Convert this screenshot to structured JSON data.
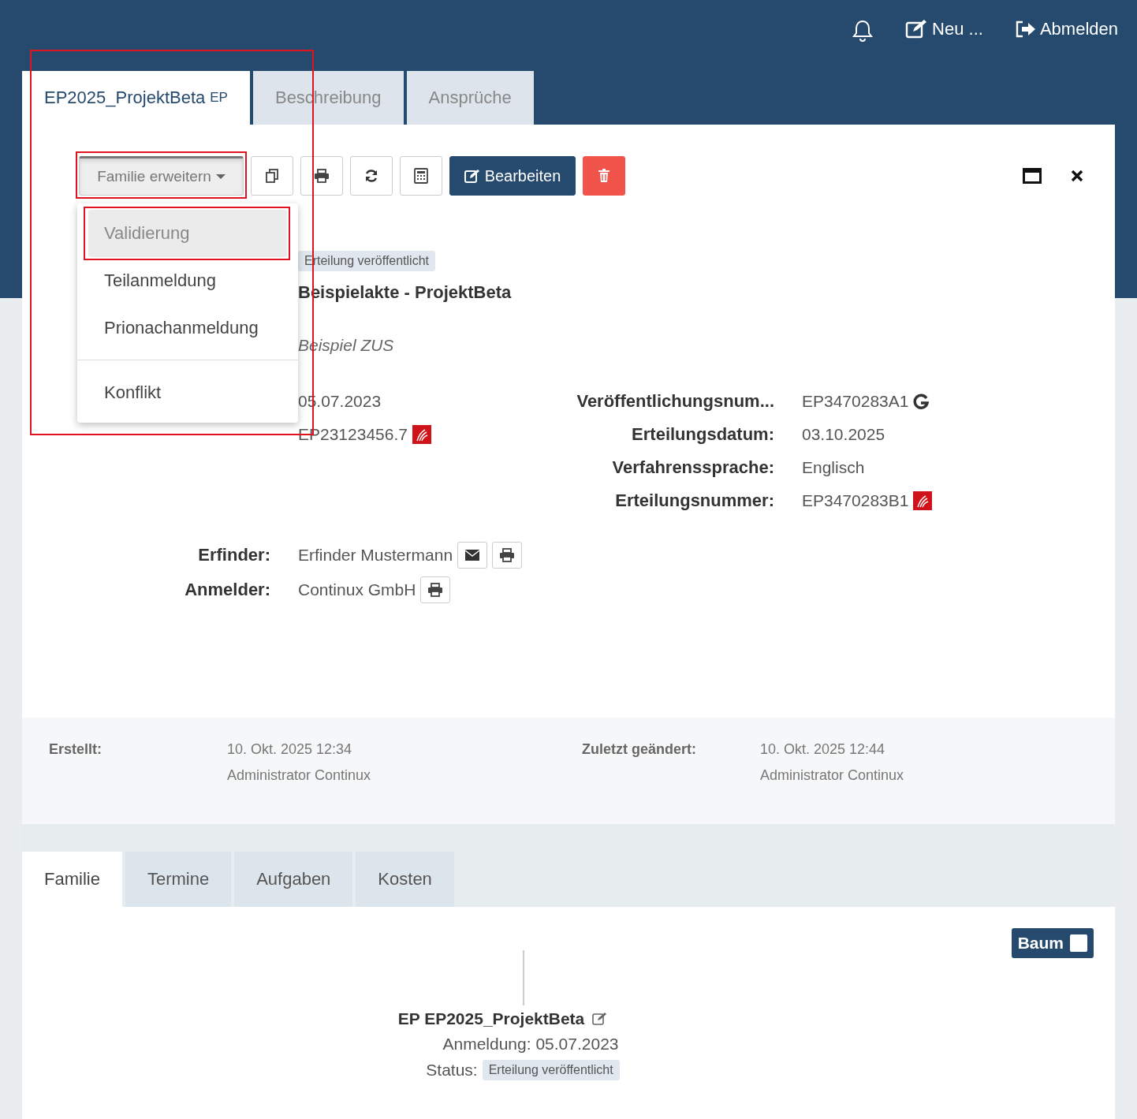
{
  "header": {
    "actions": [
      {
        "kind": "bell"
      },
      {
        "kind": "new",
        "label": "Neu ..."
      },
      {
        "kind": "logout",
        "label": "Abmelden"
      }
    ]
  },
  "tabs": [
    {
      "label": "EP2025_ProjektBeta",
      "suffix": "EP",
      "selected": true,
      "highlighted": true
    },
    {
      "label": "Beschreibung",
      "selected": false,
      "highlighted": false
    },
    {
      "label": "Ansprüche",
      "selected": false,
      "highlighted": false
    }
  ],
  "toolbar": {
    "dropdown": {
      "label": "Familie erweitern",
      "expanded": true,
      "highlighted": true
    },
    "buttons": [
      {
        "kind": "copy"
      },
      {
        "kind": "print"
      },
      {
        "kind": "refresh"
      },
      {
        "kind": "calculator"
      },
      {
        "kind": "edit",
        "label": "Bearbeiten"
      },
      {
        "kind": "delete"
      }
    ],
    "window_actions": [
      {
        "kind": "maximize"
      },
      {
        "kind": "close"
      }
    ]
  },
  "menu": {
    "items": [
      {
        "label": "Validierung",
        "selected": true,
        "highlighted": true,
        "divider_before": false
      },
      {
        "label": "Teilanmeldung",
        "selected": false,
        "highlighted": false,
        "divider_before": false
      },
      {
        "label": "Prionachanmeldung",
        "selected": false,
        "highlighted": false,
        "divider_before": false
      },
      {
        "label": "Konflikt",
        "selected": false,
        "highlighted": false,
        "divider_before": true
      }
    ]
  },
  "details": {
    "status": "Erteilung veröffentlicht",
    "title": "Beispielakte - ProjektBeta",
    "subtitle": "Beispiel ZUS",
    "fields_left": [
      {
        "value": "05.07.2023"
      },
      {
        "value": "EP23123456.7",
        "kind": "pdf"
      }
    ],
    "fields_right": [
      {
        "label": "Veröffentlichungsnum...",
        "value": "EP3470283A1",
        "kind": "google"
      },
      {
        "label": "Erteilungsdatum:",
        "value": "03.10.2025"
      },
      {
        "label": "Verfahrenssprache:",
        "value": "Englisch"
      },
      {
        "label": "Erteilungsnummer:",
        "value": "EP3470283B1",
        "kind": "pdf"
      }
    ],
    "parties": [
      {
        "label": "Erfinder:",
        "value": "Erfinder Mustermann",
        "actions": [
          {
            "kind": "mail"
          },
          {
            "kind": "print"
          }
        ]
      },
      {
        "label": "Anmelder:",
        "value": "Continux GmbH",
        "actions": [
          {
            "kind": "print"
          }
        ]
      }
    ]
  },
  "meta": [
    {
      "label": "Erstellt:",
      "date": "10. Okt. 2025 12:34",
      "user": "Administrator Continux"
    },
    {
      "label": "Zuletzt geändert:",
      "date": "10. Okt. 2025 12:44",
      "user": "Administrator Continux"
    }
  ],
  "bottom_tabs": [
    {
      "label": "Familie",
      "selected": true
    },
    {
      "label": "Termine",
      "selected": false
    },
    {
      "label": "Aufgaben",
      "selected": false
    },
    {
      "label": "Kosten",
      "selected": false
    }
  ],
  "tree": {
    "toggle": {
      "label": "Baum",
      "checked": false
    },
    "node": {
      "title": "EP EP2025_ProjektBeta",
      "filing": "Anmeldung: 05.07.2023",
      "status_label": "Status:",
      "status": "Erteilung veröffentlicht"
    }
  }
}
